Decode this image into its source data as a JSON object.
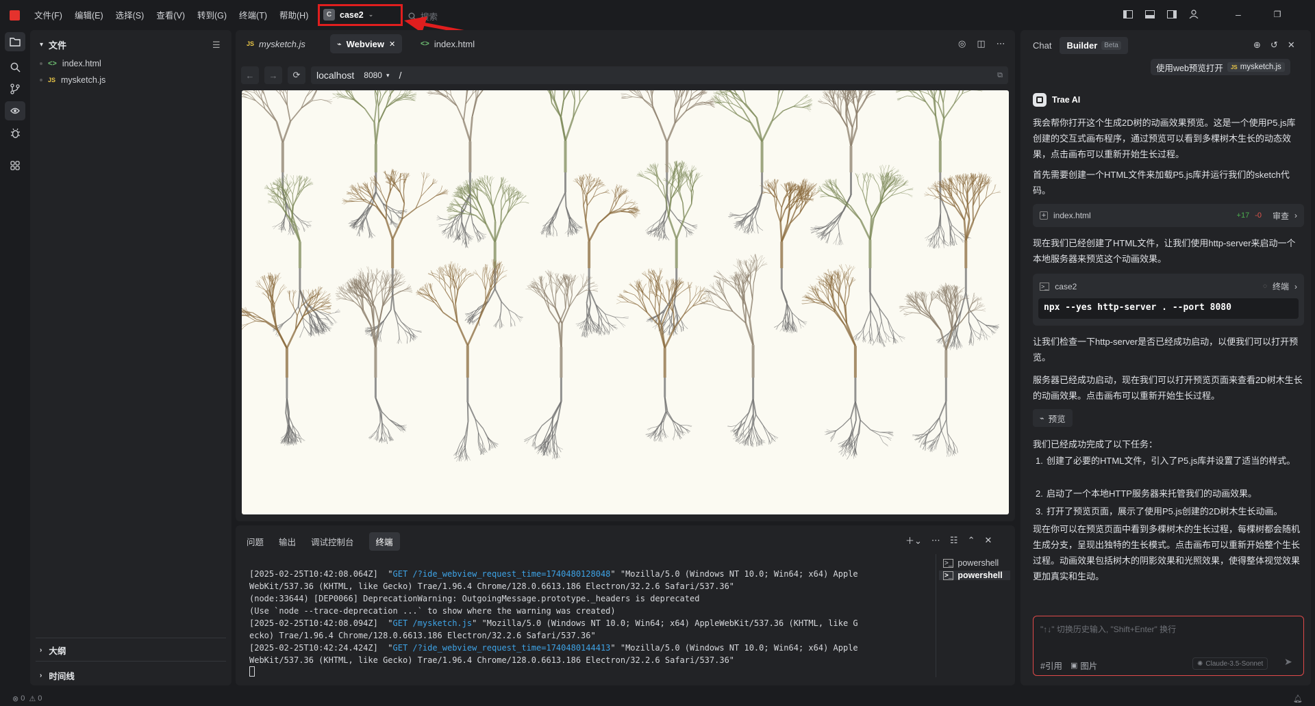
{
  "titlebar": {
    "menu": [
      "文件(F)",
      "编辑(E)",
      "选择(S)",
      "查看(V)",
      "转到(G)",
      "终端(T)",
      "帮助(H)"
    ],
    "project_badge": "C",
    "project_name": "case2",
    "search_placeholder": "搜索"
  },
  "explorer": {
    "header": "文件",
    "files": [
      {
        "badge": "<>",
        "name": "index.html"
      },
      {
        "badge": "JS",
        "name": "mysketch.js"
      }
    ],
    "outline": "大纲",
    "timeline": "时间线"
  },
  "editor": {
    "tabs": [
      {
        "badge": "JS",
        "label": "mysketch.js"
      },
      {
        "badge": "⌘",
        "label": "Webview"
      },
      {
        "badge": "<>",
        "label": "index.html"
      }
    ],
    "address": {
      "host": "localhost",
      "port": "8080",
      "path": "/"
    }
  },
  "terminal": {
    "tabs": [
      "问题",
      "输出",
      "调试控制台",
      "终端"
    ],
    "lines": [
      {
        "a": "[2025-02-25T10:42:08.064Z]  \"",
        "u": "GET /?ide_webview_request_time=1740480128048",
        "b": "\" \"Mozilla/5.0 (Windows NT 10.0; Win64; x64) Apple"
      },
      {
        "a": "WebKit/537.36 (KHTML, like Gecko) Trae/1.96.4 Chrome/128.0.6613.186 Electron/32.2.6 Safari/537.36\"",
        "u": "",
        "b": ""
      },
      {
        "a": "(node:33644) [DEP0066] DeprecationWarning: OutgoingMessage.prototype._headers is deprecated",
        "u": "",
        "b": ""
      },
      {
        "a": "(Use `node --trace-deprecation ...` to show where the warning was created)",
        "u": "",
        "b": ""
      },
      {
        "a": "[2025-02-25T10:42:08.094Z]  \"",
        "u": "GET /mysketch.js",
        "b": "\" \"Mozilla/5.0 (Windows NT 10.0; Win64; x64) AppleWebKit/537.36 (KHTML, like G"
      },
      {
        "a": "ecko) Trae/1.96.4 Chrome/128.0.6613.186 Electron/32.2.6 Safari/537.36\"",
        "u": "",
        "b": ""
      },
      {
        "a": "[2025-02-25T10:42:24.424Z]  \"",
        "u": "GET /?ide_webview_request_time=1740480144413",
        "b": "\" \"Mozilla/5.0 (Windows NT 10.0; Win64; x64) Apple"
      },
      {
        "a": "WebKit/537.36 (KHTML, like Gecko) Trae/1.96.4 Chrome/128.0.6613.186 Electron/32.2.6 Safari/537.36\"",
        "u": "",
        "b": ""
      }
    ],
    "shells": [
      "powershell",
      "powershell"
    ]
  },
  "chat": {
    "tab_chat": "Chat",
    "tab_builder": "Builder",
    "beta": "Beta",
    "user_msg": "使用web预览打开",
    "user_file_badge": "JS",
    "user_file": "mysketch.js",
    "ai_name": "Trae AI",
    "p1": "我会帮你打开这个生成2D树的动画效果预览。这是一个使用P5.js库创建的交互式画布程序，通过预览可以看到多棵树木生长的动态效果，点击画布可以重新开始生长过程。",
    "p2": "首先需要创建一个HTML文件来加载P5.js库并运行我们的sketch代码。",
    "file_card": {
      "name": "index.html",
      "plus": "+17",
      "minus": "-0",
      "action": "审查"
    },
    "p3": "现在我们已经创建了HTML文件，让我们使用http-server来启动一个本地服务器来预览这个动画效果。",
    "cmd_card": {
      "name": "case2",
      "action": "终端",
      "command": "npx --yes http-server . --port 8080"
    },
    "p4": "让我们检查一下http-server是否已经成功启动，以便我们可以打开预览。",
    "p5": "服务器已经成功启动，现在我们可以打开预览页面来查看2D树木生长的动画效果。点击画布可以重新开始生长过程。",
    "preview_btn": "预览",
    "p6": "我们已经成功完成了以下任务：",
    "list": [
      "创建了必要的HTML文件，引入了P5.js库并设置了适当的样式。",
      "启动了一个本地HTTP服务器来托管我们的动画效果。",
      "打开了预览页面，展示了使用P5.js创建的2D树木生长动画。"
    ],
    "p7": "现在你可以在预览页面中看到多棵树木的生长过程，每棵树都会随机生成分支，呈现出独特的生长模式。点击画布可以重新开始整个生长过程。动画效果包括树木的阴影效果和光照效果，使得整体视觉效果更加真实和生动。",
    "input_placeholder": "\"↑↓\" 切换历史输入, \"Shift+Enter\" 换行",
    "ref": "#引用",
    "image": "图片",
    "model": "Claude-3.5-Sonnet"
  },
  "status": {
    "errors": "0",
    "warnings": "0"
  },
  "colors": {
    "accent_red": "#e01e1e",
    "link_blue": "#3ea3e6",
    "diff_green": "#4caf50",
    "diff_red": "#e0554c"
  }
}
